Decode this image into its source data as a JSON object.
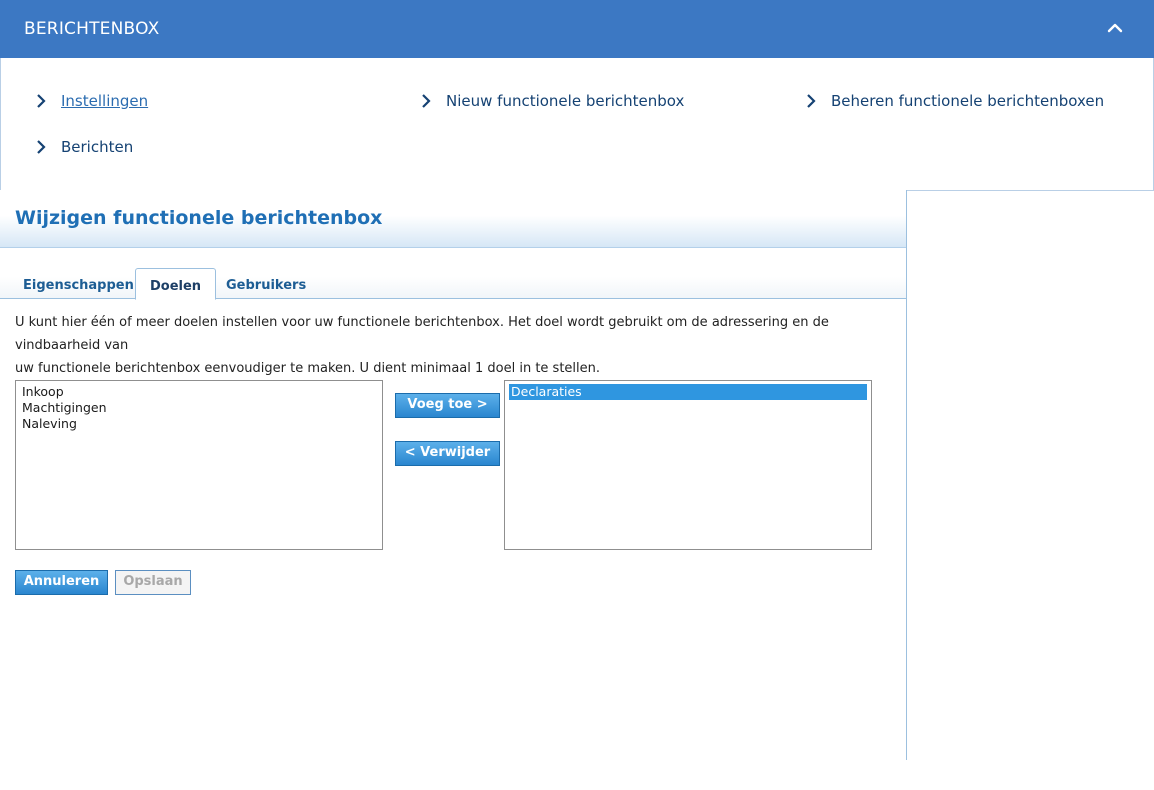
{
  "header": {
    "title": "BERICHTENBOX"
  },
  "nav": {
    "items": [
      {
        "label": "Instellingen"
      },
      {
        "label": "Nieuw functionele berichtenbox"
      },
      {
        "label": "Beheren functionele berichtenboxen"
      },
      {
        "label": "Berichten"
      }
    ],
    "active": "Instellingen"
  },
  "page": {
    "title": "Wijzigen functionele berichtenbox",
    "tabs": [
      {
        "label": "Eigenschappen"
      },
      {
        "label": "Doelen"
      },
      {
        "label": "Gebruikers"
      }
    ],
    "active_tab": "Doelen",
    "intro_line1": "U kunt hier één of meer doelen instellen voor uw functionele berichtenbox. Het doel wordt gebruikt om de adressering en de vindbaarheid van",
    "intro_line2": "uw functionele berichtenbox eenvoudiger te maken. U dient minimaal 1 doel in te stellen."
  },
  "available_list": {
    "options": [
      "Inkoop",
      "Machtigingen",
      "Naleving"
    ]
  },
  "selected_list": {
    "options": [
      "Declaraties"
    ],
    "selected": "Declaraties"
  },
  "buttons": {
    "add": "Voeg toe >",
    "remove": "< Verwijder",
    "cancel": "Annuleren",
    "save": "Opslaan"
  },
  "colors": {
    "brand": "#3c78c3",
    "link": "#154273",
    "accent": "#2f96e0"
  }
}
